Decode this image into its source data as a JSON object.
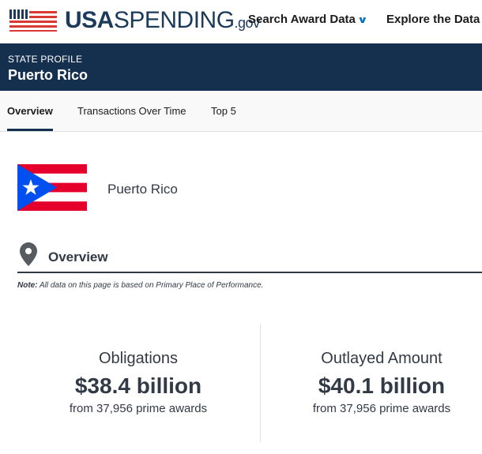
{
  "header": {
    "logo": {
      "usa": "USA",
      "spending": "SPENDING",
      "gov": ".gov"
    },
    "nav": [
      {
        "label": "Search Award Data",
        "icon": "chevron-down-icon"
      },
      {
        "label": "Explore the Data",
        "icon": "chevron-down-icon"
      }
    ]
  },
  "banner": {
    "label": "STATE PROFILE",
    "title": "Puerto Rico"
  },
  "tabs": [
    {
      "label": "Overview",
      "active": true
    },
    {
      "label": "Transactions Over Time",
      "active": false
    },
    {
      "label": "Top 5",
      "active": false
    }
  ],
  "state": {
    "name": "Puerto Rico",
    "flag_icon": "puerto-rico-flag-icon"
  },
  "section": {
    "title": "Overview",
    "icon": "map-pin-icon"
  },
  "note": {
    "label": "Note:",
    "text": " All data on this page is based on Primary Place of Performance."
  },
  "stats": [
    {
      "label": "Obligations",
      "value": "$38.4 billion",
      "sub": "from 37,956 prime awards"
    },
    {
      "label": "Outlayed Amount",
      "value": "$40.1 billion",
      "sub": "from 37,956 prime awards"
    }
  ],
  "colors": {
    "banner": "#15304f",
    "accent": "#0071bc",
    "flag_red": "#e4002b",
    "flag_blue": "#0050f0",
    "logo_red": "#d83933"
  }
}
